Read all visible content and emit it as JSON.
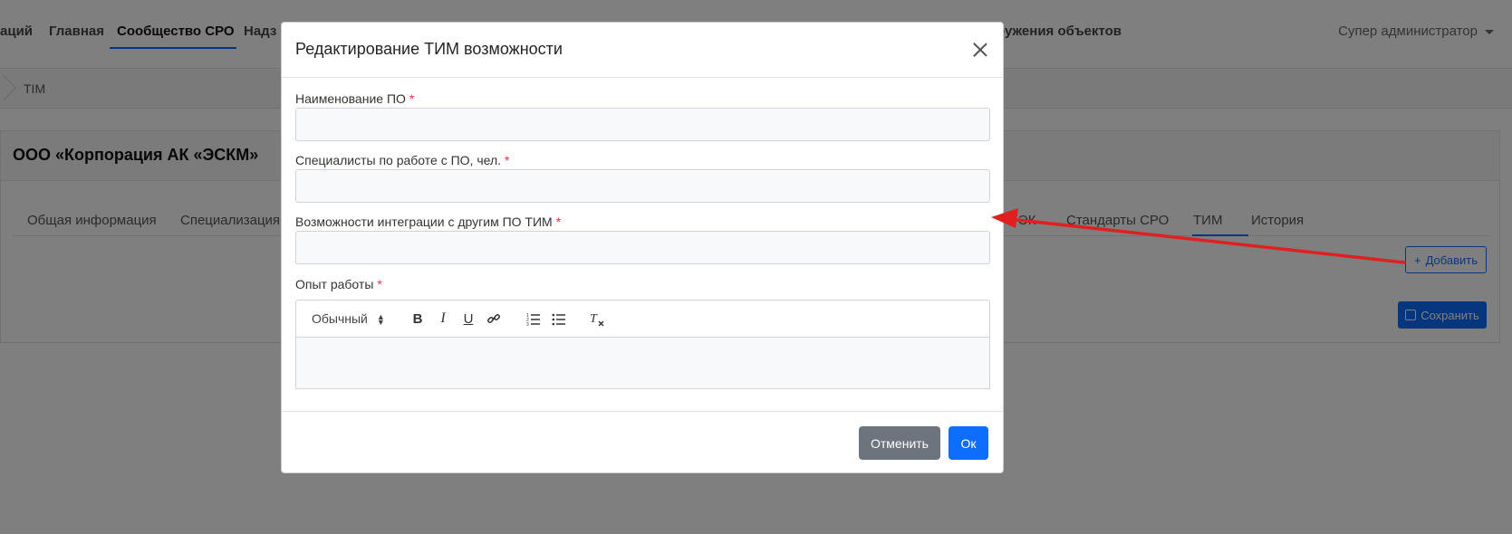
{
  "topnav": {
    "items": [
      {
        "label": "аций"
      },
      {
        "label": "Главная"
      },
      {
        "label": "Сообщество СРО"
      },
      {
        "label": "Надз"
      },
      {
        "label": "ружения объектов"
      }
    ],
    "user_menu_label": "Супер администратор"
  },
  "breadcrumb": {
    "current": "TIM"
  },
  "org": {
    "title": "ООО «Корпорация АК «ЭСКМ»"
  },
  "tabs": [
    {
      "label": "Общая информация"
    },
    {
      "label": "Специализация"
    },
    {
      "label": "ЭК"
    },
    {
      "label": "Стандарты СРО"
    },
    {
      "label": "ТИМ",
      "active": true
    },
    {
      "label": "История"
    }
  ],
  "page_buttons": {
    "add_label": "Добавить",
    "save_label": "Сохранить"
  },
  "modal": {
    "title": "Редактирование ТИМ возможности",
    "fields": [
      {
        "label": "Наименование ПО",
        "required_mark": "*",
        "value": ""
      },
      {
        "label": "Специалисты по работе с ПО, чел.",
        "required_mark": "*",
        "value": ""
      },
      {
        "label": "Возможности интеграции с другим ПО ТИМ",
        "required_mark": "*",
        "value": ""
      }
    ],
    "editor": {
      "label": "Опыт работы",
      "required_mark": "*",
      "format_select_value": "Обычный",
      "tools": [
        "bold-icon",
        "italic-icon",
        "underline-icon",
        "link-icon",
        "ordered-list-icon",
        "bullet-list-icon",
        "clear-format-icon"
      ],
      "value": ""
    },
    "cancel_label": "Отменить",
    "ok_label": "Ок"
  },
  "colors": {
    "primary": "#0d6efd",
    "secondary": "#6c757d",
    "required": "#dc3545",
    "annotation_arrow": "#e02020"
  }
}
